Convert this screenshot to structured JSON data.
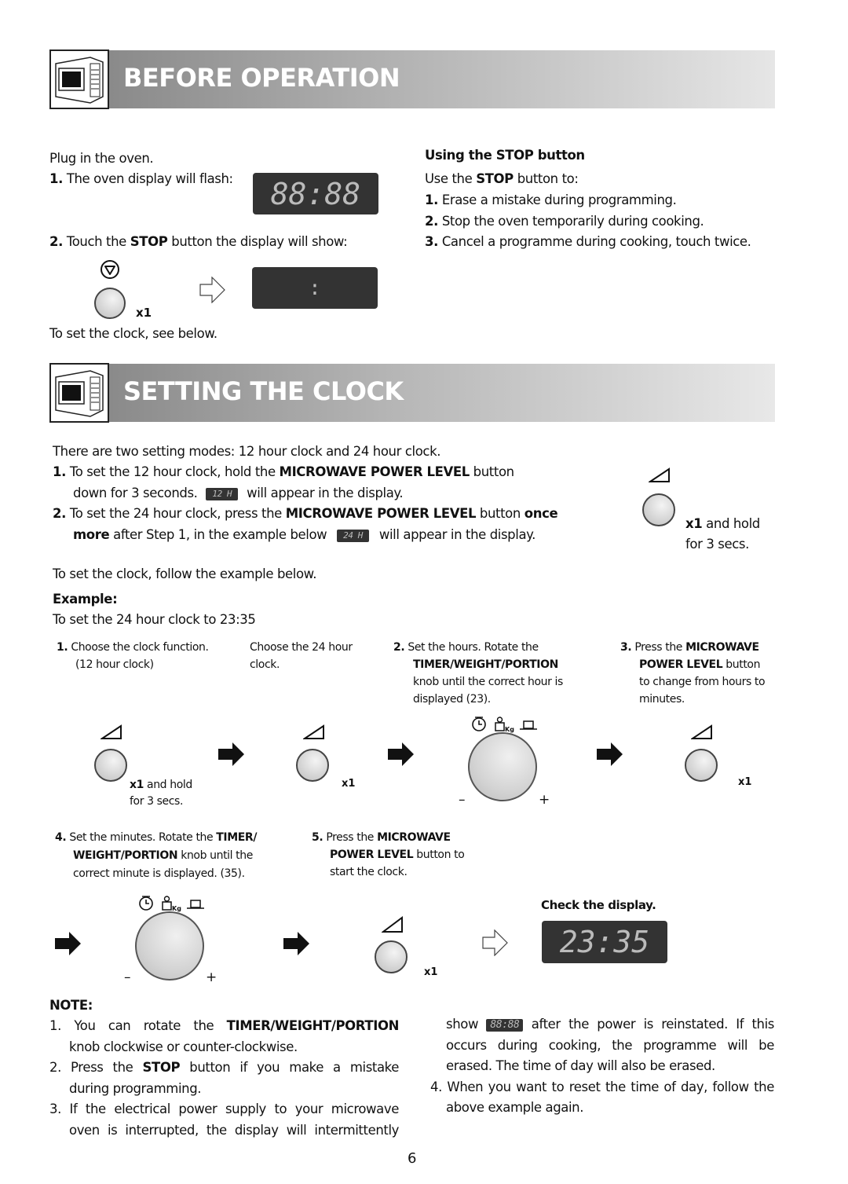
{
  "before_operation": {
    "title": "BEFORE OPERATION",
    "plug_in": "Plug in the oven.",
    "step1_num": "1.",
    "step1_text": "The oven display will flash:",
    "display_flash": "88:88",
    "step2_num": "2.",
    "step2_pre": "Touch the ",
    "step2_bold": "STOP",
    "step2_post": " button the display will show:",
    "display_blank": ":",
    "stop_count": "x1",
    "see_below": "To set the clock, see below.",
    "icons": {
      "stop": "stop-symbol-icon",
      "button": "stop-button-icon",
      "arrow": "hollow-arrow-right-icon"
    }
  },
  "using_stop": {
    "heading": "Using the STOP button",
    "intro_pre": "Use the ",
    "intro_bold": "STOP",
    "intro_post": " button to:",
    "items": [
      {
        "num": "1.",
        "text": "Erase a mistake during programming."
      },
      {
        "num": "2.",
        "text": "Stop the oven temporarily during cooking."
      },
      {
        "num": "3.",
        "text": "Cancel a programme during cooking, touch twice."
      }
    ]
  },
  "setting_clock": {
    "title": "SETTING THE CLOCK",
    "intro": "There are two setting modes: 12 hour clock and 24 hour clock.",
    "item1_num": "1.",
    "item1_a": "To set the 12 hour clock, hold the ",
    "item1_bold": "MICROWAVE POWER LEVEL",
    "item1_b": " button",
    "item1_c": "down for 3 seconds.",
    "item1_display": "12 H",
    "item1_d": "will appear in the display.",
    "item2_num": "2.",
    "item2_a": "To set the 24 hour clock, press the ",
    "item2_bold": "MICROWAVE POWER LEVEL",
    "item2_b": " button ",
    "item2_bold2": "once",
    "item2_bold3": "more",
    "item2_c": " after Step 1, in the example below",
    "item2_display": "24 H",
    "item2_d": "will appear in the display.",
    "side_count": "x1",
    "side_hold": " and hold",
    "side_secs": "for 3 secs.",
    "follow": "To set the clock, follow the example below.",
    "example_label": "Example:",
    "example_text": "To set the 24 hour clock to 23:35"
  },
  "steps": {
    "s1_num": "1.",
    "s1_line1": "Choose the clock function.",
    "s1_line2": "(12 hour clock)",
    "s1b_line1": "Choose the 24 hour",
    "s1b_line2": "clock.",
    "s1_count": "x1",
    "s1_hold": " and hold",
    "s1_secs": "for 3 secs.",
    "s1b_count": "x1",
    "s2_num": "2.",
    "s2_line1": "Set the hours. Rotate the",
    "s2_bold": "TIMER/WEIGHT/PORTION",
    "s2_line3": "knob until the correct hour is",
    "s2_line4": "displayed (23).",
    "knob_minus": "–",
    "knob_plus": "+",
    "knob_kg": "Kg",
    "s3_num": "3.",
    "s3_pre": "Press the ",
    "s3_bold1": "MICROWAVE",
    "s3_bold2": "POWER LEVEL",
    "s3_post": " button",
    "s3_line3": "to change from hours to",
    "s3_line4": "minutes.",
    "s3_count": "x1",
    "s4_num": "4.",
    "s4_pre": "Set the minutes. Rotate the ",
    "s4_bold1": "TIMER/",
    "s4_bold2": "WEIGHT/PORTION",
    "s4_post": " knob until the",
    "s4_line3": "correct minute is displayed. (35).",
    "s5_num": "5.",
    "s5_pre": "Press the ",
    "s5_bold1": "MICROWAVE",
    "s5_bold2": "POWER LEVEL",
    "s5_post": " button to",
    "s5_line3": "start the clock.",
    "s5_count": "x1",
    "check": "Check the display.",
    "final_display": "23:35"
  },
  "note": {
    "label": "NOTE:",
    "n1_num": "1.",
    "n1_pre": "You can rotate the ",
    "n1_bold": "TIMER/WEIGHT/PORTION",
    "n1_line2": "knob clockwise or counter-clockwise.",
    "n2_num": "2.",
    "n2_pre": "Press the ",
    "n2_bold": "STOP",
    "n2_post": " button if you make a mistake",
    "n2_line2": "during programming.",
    "n3_num": "3.",
    "n3_line1": "If the electrical power supply to your microwave",
    "n3_line2": "oven is interrupted, the display will intermittently",
    "n3_show": "show",
    "n3_display": "88:88",
    "n3_line3b": "after the power is reinstated. If this",
    "n3_line4": "occurs during cooking, the programme will be",
    "n3_line5": "erased. The time of day will also be erased.",
    "n4_num": "4.",
    "n4_line1": "When you want to reset the time of day, follow the",
    "n4_line2": "above example again."
  },
  "page_number": "6"
}
